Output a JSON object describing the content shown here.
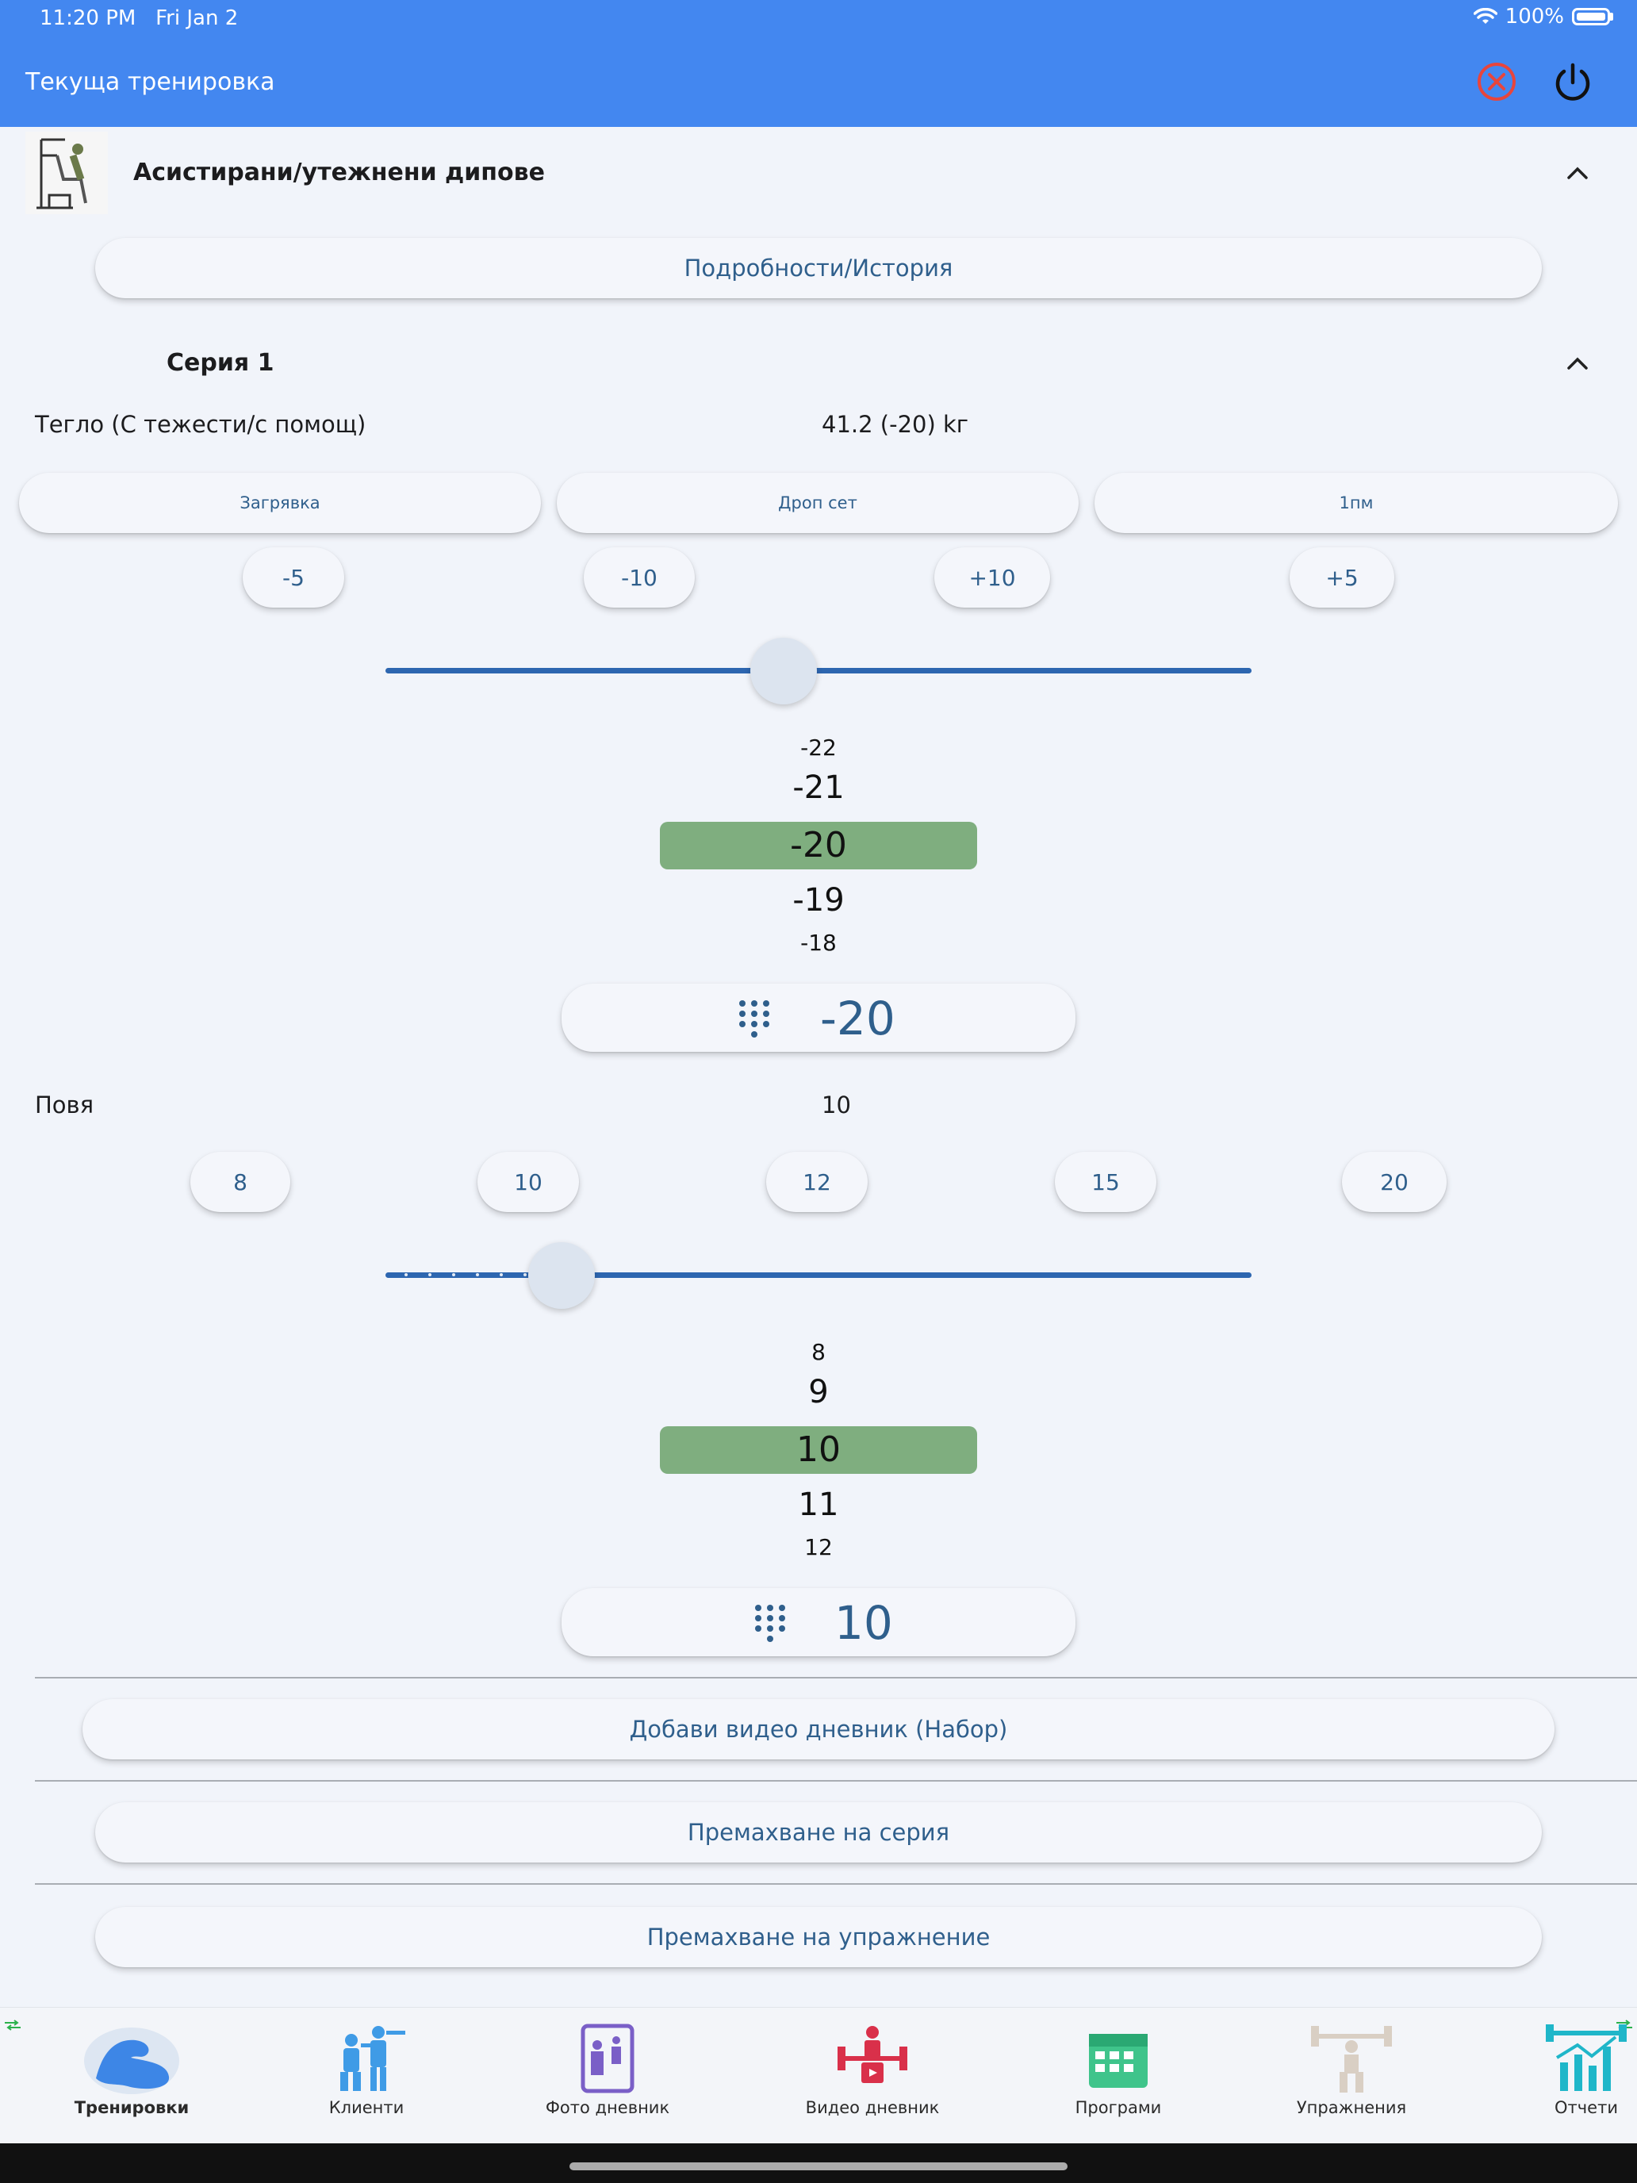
{
  "status_bar": {
    "time": "11:20 PM",
    "date": "Fri Jan 2",
    "battery": "100%"
  },
  "header": {
    "title": "Текуща тренировка",
    "icons": [
      "close-circle-icon",
      "power-icon"
    ]
  },
  "exercise": {
    "name": "Асистирани/утежнени дипове",
    "details_button": "Подробности/История"
  },
  "set": {
    "title": "Серия 1",
    "weight": {
      "label": "Тегло (С тежести/с помощ)",
      "value": "41.2 (-20) kг",
      "type_buttons": [
        "Загрявка",
        "Дроп сет",
        "1пм"
      ],
      "step_buttons": [
        "-5",
        "-10",
        "+10",
        "+5"
      ],
      "slider_level": 0.46,
      "wheel": [
        "-22",
        "-21",
        "-20",
        "-19",
        "-18"
      ],
      "input_value": "-20"
    },
    "reps": {
      "label": "Повя",
      "value": "10",
      "quick_buttons": [
        "8",
        "10",
        "12",
        "15",
        "20"
      ],
      "slider_level": 0.2,
      "wheel": [
        "8",
        "9",
        "10",
        "11",
        "12"
      ],
      "input_value": "10"
    }
  },
  "actions": {
    "add_video": "Добави видео дневник (Набор)",
    "remove_set": "Премахване на серия",
    "remove_exercise": "Премахване на упражнение"
  },
  "bottom_nav": [
    {
      "label": "Тренировки",
      "icon": "bicep-icon",
      "active": true
    },
    {
      "label": "Клиенти",
      "icon": "trainer-clients-icon",
      "active": false
    },
    {
      "label": "Фото дневник",
      "icon": "photo-journal-icon",
      "active": false
    },
    {
      "label": "Видео дневник",
      "icon": "video-journal-icon",
      "active": false
    },
    {
      "label": "Програми",
      "icon": "calendar-program-icon",
      "active": false
    },
    {
      "label": "Упражнения",
      "icon": "weightlifter-icon",
      "active": false
    },
    {
      "label": "Отчети",
      "icon": "reports-chart-icon",
      "active": false
    }
  ],
  "colors": {
    "header": "#4387f0",
    "accent": "#2f5f8c",
    "selection": "#7fae7f",
    "close_icon": "#e8453c"
  }
}
